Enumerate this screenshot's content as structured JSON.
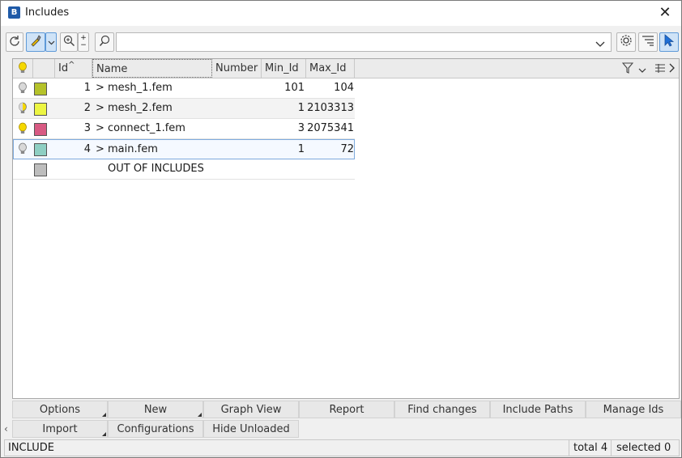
{
  "window": {
    "title": "Includes",
    "icon": "app-logo-icon",
    "close_icon": "close-icon"
  },
  "toolbar": {
    "search_value": "",
    "icons": [
      "refresh-icon",
      "highlight-pen-icon",
      "dropdown-icon",
      "zoom-fit-icon",
      "zoom-in-out-icon",
      "search-icon",
      "dropdown-icon",
      "settings-icon",
      "tree-list-icon",
      "select-pointer-icon"
    ]
  },
  "grid": {
    "columns": [
      "",
      "",
      "Id",
      "Name",
      "Number",
      "Min_Id",
      "Max_Id"
    ],
    "rows": [
      {
        "bulb": "off",
        "color": "#b5c22a",
        "id": "1",
        "name": "mesh_1.fem",
        "expand": true,
        "number": "",
        "min_id": "101",
        "max_id": "104"
      },
      {
        "bulb": "half",
        "color": "#ecf542",
        "id": "2",
        "name": "mesh_2.fem",
        "expand": true,
        "number": "",
        "min_id": "1",
        "max_id": "2103313"
      },
      {
        "bulb": "on",
        "color": "#d85a83",
        "id": "3",
        "name": "connect_1.fem",
        "expand": true,
        "number": "",
        "min_id": "3",
        "max_id": "2075341"
      },
      {
        "bulb": "off",
        "color": "#8ecfc3",
        "id": "4",
        "name": "main.fem",
        "expand": true,
        "number": "",
        "min_id": "1",
        "max_id": "72"
      },
      {
        "bulb": "",
        "color": "#bdbdbd",
        "id": "",
        "name": "OUT OF INCLUDES",
        "expand": false,
        "number": "",
        "min_id": "",
        "max_id": ""
      }
    ]
  },
  "buttons_row1": [
    "Options",
    "New",
    "Graph View",
    "Report",
    "Find changes",
    "Include Paths",
    "Manage Ids"
  ],
  "buttons_row2": [
    "Import",
    "Configurations",
    "Hide Unloaded"
  ],
  "status": {
    "left": "INCLUDE",
    "total": "total 4",
    "selected": "selected 0"
  },
  "colors": {
    "accent": "#1f5aa8",
    "selection": "#7eaadd"
  }
}
